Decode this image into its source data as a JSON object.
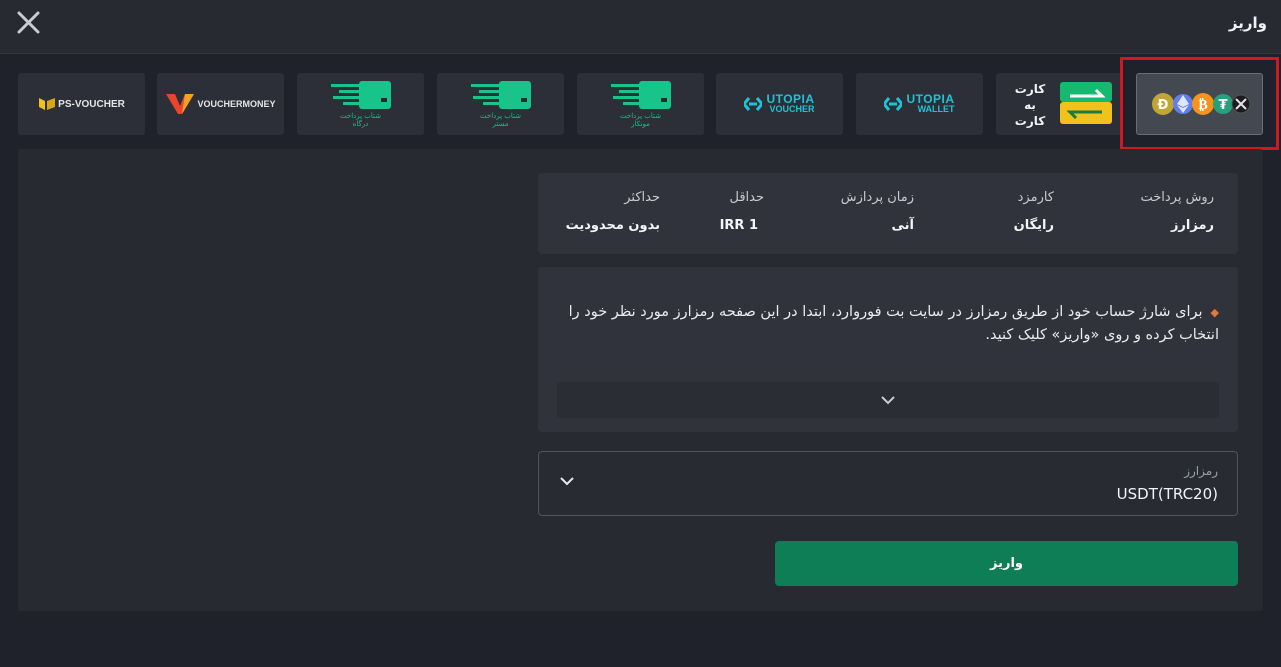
{
  "header": {
    "title": "واریز"
  },
  "methods": [
    {
      "id": "crypto",
      "label": "",
      "selected": true
    },
    {
      "id": "card-to-card",
      "label": "کارت به کارت"
    },
    {
      "id": "utopia-wallet",
      "label": "UTOPIA",
      "sub": "WALLET"
    },
    {
      "id": "utopia-voucher",
      "label": "UTOPIA",
      "sub": "VOUCHER"
    },
    {
      "id": "shetab-1",
      "label": "شتاب پرداخت",
      "sub": "مونکار"
    },
    {
      "id": "shetab-2",
      "label": "شتاب پرداخت",
      "sub": "مستر"
    },
    {
      "id": "shetab-3",
      "label": "شتاب پرداخت",
      "sub": "درگاه"
    },
    {
      "id": "vouchermoney",
      "label": "VOUCHERMONEY"
    },
    {
      "id": "ps-voucher",
      "label": "PS-VOUCHER"
    }
  ],
  "info": {
    "columns": [
      {
        "header": "روش پرداخت",
        "value": "رمزارز"
      },
      {
        "header": "کارمزد",
        "value": "رایگان"
      },
      {
        "header": "زمان پردازش",
        "value": "آنی"
      },
      {
        "header": "حداقل",
        "value": "IRR 1"
      },
      {
        "header": "حداکثر",
        "value": "بدون محدودیت"
      }
    ]
  },
  "notice": {
    "text": "برای شارژ حساب خود از طریق رمزارز در سایت بت فوروارد، ابتدا در این صفحه رمزارز مورد نظر خود را انتخاب کرده و روی «واریز» کلیک کنید."
  },
  "currency_select": {
    "label": "رمزارز",
    "value": "USDT(TRC20)"
  },
  "submit": {
    "label": "واریز"
  },
  "colors": {
    "accent_green": "#0d7e56",
    "highlight_red": "#d0181f",
    "shetab_green": "#17c48a"
  }
}
